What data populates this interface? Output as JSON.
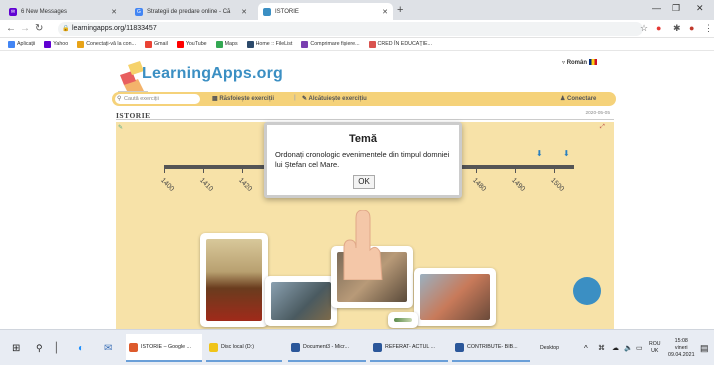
{
  "browser": {
    "tabs": [
      {
        "label": "6 New Messages"
      },
      {
        "label": "Strategii de predare online - Că"
      },
      {
        "label": "ISTORIE"
      }
    ],
    "new_tab": "+",
    "url": "learningapps.org/11833457",
    "bookmarks": [
      {
        "label": "Aplicații",
        "color": "#4285f4"
      },
      {
        "label": "Yahoo",
        "color": "#6001d2"
      },
      {
        "label": "Conectați-vă la con...",
        "color": "#e8a317"
      },
      {
        "label": "Gmail",
        "color": "#ea4335"
      },
      {
        "label": "YouTube",
        "color": "#ff0000"
      },
      {
        "label": "Maps",
        "color": "#34a853"
      },
      {
        "label": "Home :: FileList",
        "color": "#2c4a6b"
      },
      {
        "label": "Comprimare fișiere...",
        "color": "#7a3fb0"
      },
      {
        "label": "CRED ÎN EDUCAȚIE...",
        "color": "#d9534f"
      }
    ]
  },
  "site": {
    "logo": "LearningApps.org",
    "language": "Român",
    "search_placeholder": "Caută exerciții",
    "browse_label": "Răsfoiește exerciții",
    "create_label": "Alcătuiește exercițiu",
    "login_label": "Conectare",
    "page_title": "ISTORIE",
    "date": "2020-05-05"
  },
  "timeline": {
    "years": [
      "1400",
      "1410",
      "1420",
      "1480",
      "1490",
      "1500"
    ]
  },
  "dialog": {
    "title": "Temă",
    "body": "Ordonați cronologic evenimentele din timpul domniei lui Ștefan cel Mare.",
    "ok": "OK"
  },
  "taskbar": {
    "apps": [
      {
        "label": "ISTORIE – Google ...",
        "color": "#dd5a2c"
      },
      {
        "label": "Disc local (D:)",
        "color": "#f0c419"
      },
      {
        "label": "Document3 - Micr...",
        "color": "#2b579a"
      },
      {
        "label": "REFERAT- ACTUL ...",
        "color": "#2b579a"
      },
      {
        "label": "CONTRIBUTE- BIB...",
        "color": "#2b579a"
      }
    ],
    "desktop": "Desktop",
    "lang": "ROU",
    "lang2": "UK",
    "time": "15:08",
    "day": "vineri",
    "date": "09.04.2021"
  }
}
